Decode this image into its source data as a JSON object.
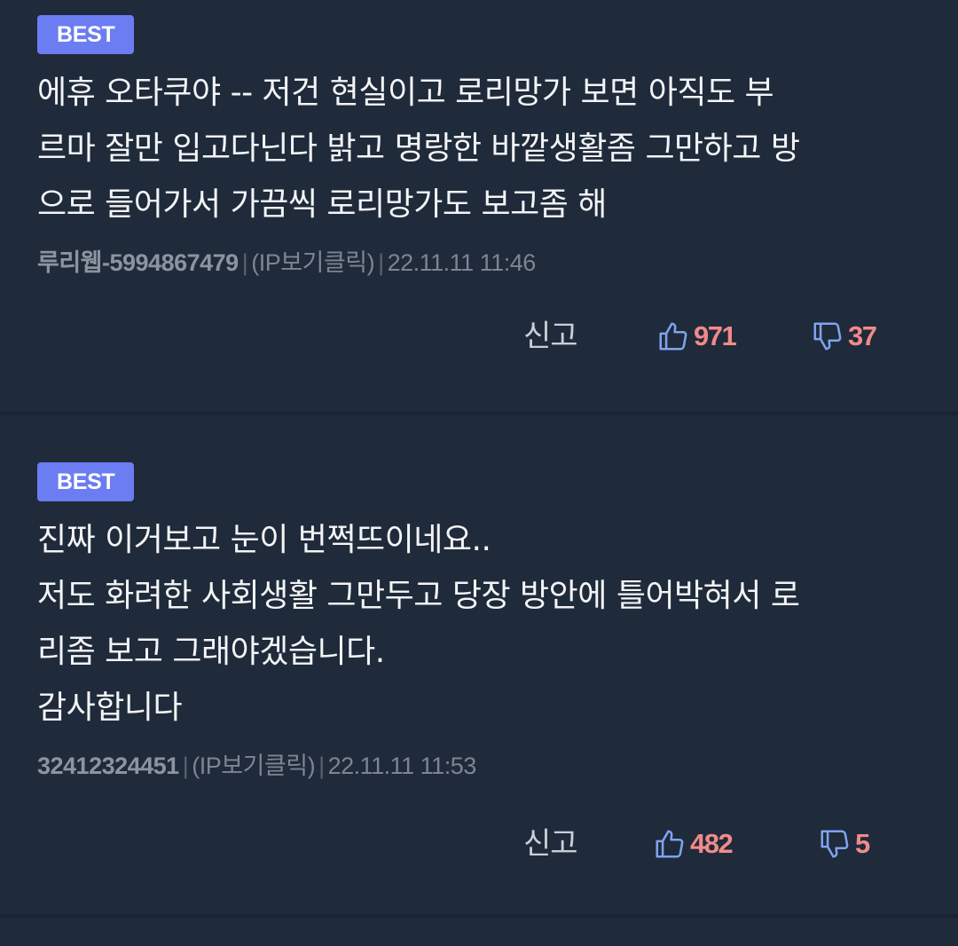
{
  "comments": [
    {
      "badge": "BEST",
      "lines": [
        "에휴 오타쿠야 -- 저건 현실이고 로리망가 보면 아직도 부",
        "르마 잘만 입고다닌다 밝고 명랑한 바깥생활좀 그만하고 방",
        "으로 들어가서 가끔씩 로리망가도 보고좀 해"
      ],
      "author": "루리웹-5994867479",
      "ip_label": "(IP보기클릭)",
      "timestamp": "22.11.11 11:46",
      "report_label": "신고",
      "upvotes": "971",
      "downvotes": "37"
    },
    {
      "badge": "BEST",
      "lines": [
        "진짜 이거보고 눈이 번쩍뜨이네요..",
        "저도 화려한 사회생활 그만두고 당장 방안에 틀어박혀서 로",
        "리좀 보고 그래야겠습니다.",
        "감사합니다"
      ],
      "author": "32412324451",
      "ip_label": "(IP보기클릭)",
      "timestamp": "22.11.11 11:53",
      "report_label": "신고",
      "upvotes": "482",
      "downvotes": "5"
    }
  ],
  "colors": {
    "background": "#1f2a3a",
    "badge": "#6c7cf2",
    "vote_count": "#f08a8a",
    "vote_icon": "#7fa3ee"
  },
  "icons": {
    "upvote": "thumbs-up-icon",
    "downvote": "thumbs-down-icon"
  }
}
